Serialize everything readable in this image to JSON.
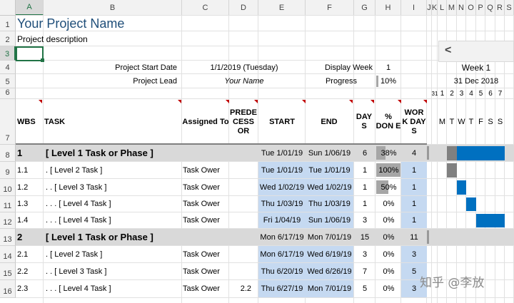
{
  "columns": [
    "A",
    "B",
    "C",
    "D",
    "E",
    "F",
    "G",
    "H",
    "I",
    "J",
    "K",
    "L",
    "M",
    "N",
    "O",
    "P",
    "Q",
    "R",
    "S"
  ],
  "rows": [
    "1",
    "2",
    "3",
    "4",
    "5",
    "6",
    "7",
    "8",
    "9",
    "10",
    "11",
    "12",
    "13",
    "14",
    "15",
    "16"
  ],
  "title": "Your Project Name",
  "description": "Project description",
  "start_date_label": "Project Start Date",
  "start_date_value": "1/1/2019 (Tuesday)",
  "display_week_label": "Display Week",
  "display_week_value": "1",
  "project_lead_label": "Project Lead",
  "project_lead_value": "Your Name",
  "progress_label": "Progress",
  "progress_value": "10%",
  "progress_fraction": 0.1,
  "nav_arrow": "<",
  "week_label": "Week 1",
  "week_date": "31 Dec 2018",
  "day_numbers": [
    "31",
    "1",
    "2",
    "3",
    "4",
    "5",
    "6",
    "7"
  ],
  "day_letters": [
    "M",
    "T",
    "W",
    "T",
    "F",
    "S",
    "S"
  ],
  "headers": {
    "wbs": "WBS",
    "task": "TASK",
    "assigned": "Assigned To",
    "predecessor": "PREDE CESS OR",
    "start": "START",
    "end": "END",
    "days": "DAY S",
    "done": "% DON E",
    "workdays": "WOR K DAY S"
  },
  "tasks": [
    {
      "wbs": "1",
      "task": "[ Level 1 Task or Phase ]",
      "assigned": "",
      "pred": "",
      "start": "Tue 1/01/19",
      "end": "Sun 1/06/19",
      "days": "6",
      "done": "38%",
      "done_frac": 0.38,
      "work": "4",
      "level1": true
    },
    {
      "wbs": "1.1",
      "task": ". [ Level 2 Task ]",
      "assigned": "Task Ower",
      "pred": "",
      "start": "Tue 1/01/19",
      "end": "Tue 1/01/19",
      "days": "1",
      "done": "100%",
      "done_frac": 1.0,
      "work": "1",
      "level1": false
    },
    {
      "wbs": "1.2",
      "task": ". . [ Level 3 Task ]",
      "assigned": "Task Ower",
      "pred": "",
      "start": "Wed 1/02/19",
      "end": "Wed 1/02/19",
      "days": "1",
      "done": "50%",
      "done_frac": 0.5,
      "work": "1",
      "level1": false
    },
    {
      "wbs": "1.3",
      "task": ". . . [ Level 4 Task ]",
      "assigned": "Task Ower",
      "pred": "",
      "start": "Thu 1/03/19",
      "end": "Thu 1/03/19",
      "days": "1",
      "done": "0%",
      "done_frac": 0,
      "work": "1",
      "level1": false
    },
    {
      "wbs": "1.4",
      "task": ". . . [ Level 4 Task ]",
      "assigned": "Task Ower",
      "pred": "",
      "start": "Fri 1/04/19",
      "end": "Sun 1/06/19",
      "days": "3",
      "done": "0%",
      "done_frac": 0,
      "work": "1",
      "level1": false
    },
    {
      "wbs": "2",
      "task": "[ Level 1 Task or Phase ]",
      "assigned": "",
      "pred": "",
      "start": "Mon 6/17/19",
      "end": "Mon 7/01/19",
      "days": "15",
      "done": "0%",
      "done_frac": 0,
      "work": "11",
      "level1": true
    },
    {
      "wbs": "2.1",
      "task": ". [ Level 2 Task ]",
      "assigned": "Task Ower",
      "pred": "",
      "start": "Mon 6/17/19",
      "end": "Wed 6/19/19",
      "days": "3",
      "done": "0%",
      "done_frac": 0,
      "work": "3",
      "level1": false
    },
    {
      "wbs": "2.2",
      "task": ". . [ Level 3 Task ]",
      "assigned": "Task Ower",
      "pred": "",
      "start": "Thu 6/20/19",
      "end": "Wed 6/26/19",
      "days": "7",
      "done": "0%",
      "done_frac": 0,
      "work": "5",
      "level1": false
    },
    {
      "wbs": "2.3",
      "task": ". . . [ Level 4 Task ]",
      "assigned": "Task Ower",
      "pred": "2.2",
      "start": "Thu 6/27/19",
      "end": "Mon 7/01/19",
      "days": "5",
      "done": "0%",
      "done_frac": 0,
      "work": "3",
      "level1": false
    }
  ],
  "gantt_colors": {
    "done": "#808080",
    "todo": "#0070c0"
  },
  "watermark": "知乎 @李放"
}
